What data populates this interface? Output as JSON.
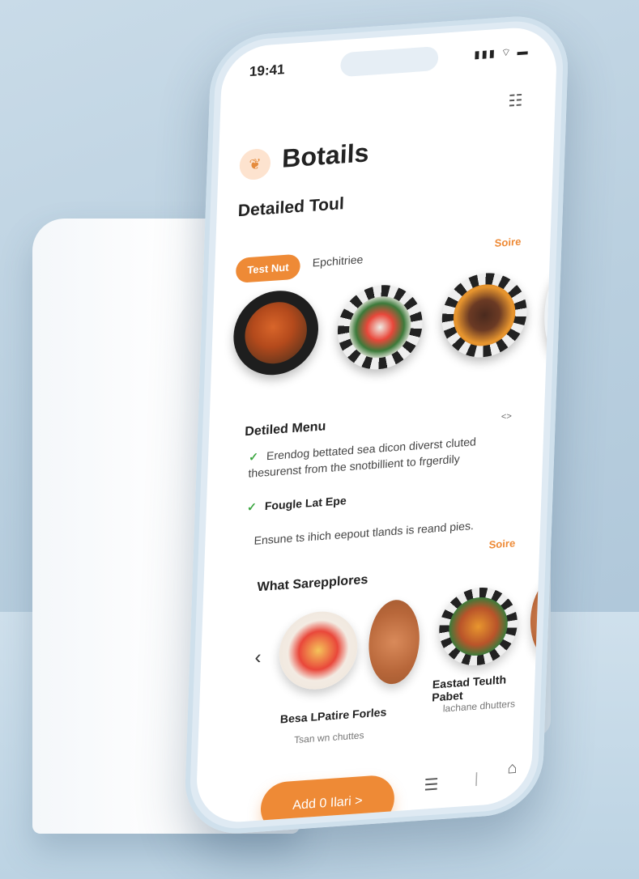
{
  "status_bar": {
    "time": "19:41",
    "icons": "signal wifi battery"
  },
  "header": {
    "top_icon": "document-icon",
    "logo_icon": "food-icon",
    "app_title": "Botails"
  },
  "section": {
    "title": "Detailed Toul"
  },
  "tabs": {
    "active": "Test Nut",
    "inactive": "Epchitriee",
    "see_all": "Soire"
  },
  "food_images": [
    "fried-dish",
    "salad-plate",
    "roast-plate",
    "partial-plate"
  ],
  "menu": {
    "heading": "Detiled Menu",
    "code_icon": "<>",
    "items": [
      {
        "text": "Erendog bettated sea dicon diverst cluted thesurenst from the snotbillient to frgerdily"
      },
      {
        "text": "Fougle Lat Epe"
      }
    ],
    "description": "Ensune ts ihich eepout tlands is reand pies."
  },
  "suggestions": {
    "see_all": "Soire",
    "title": "What Sarepplores",
    "cards": [
      {
        "title": "Besa LPatire Forles",
        "subtitle": "Tsan wn chuttes"
      },
      {
        "title": "Eastad Teulth Pabet",
        "subtitle": "lachane dhutters"
      }
    ]
  },
  "actions": {
    "add_button": "Add 0 Ilari  >"
  },
  "colors": {
    "accent": "#ee8a36",
    "check": "#3aa640",
    "text": "#222222"
  }
}
